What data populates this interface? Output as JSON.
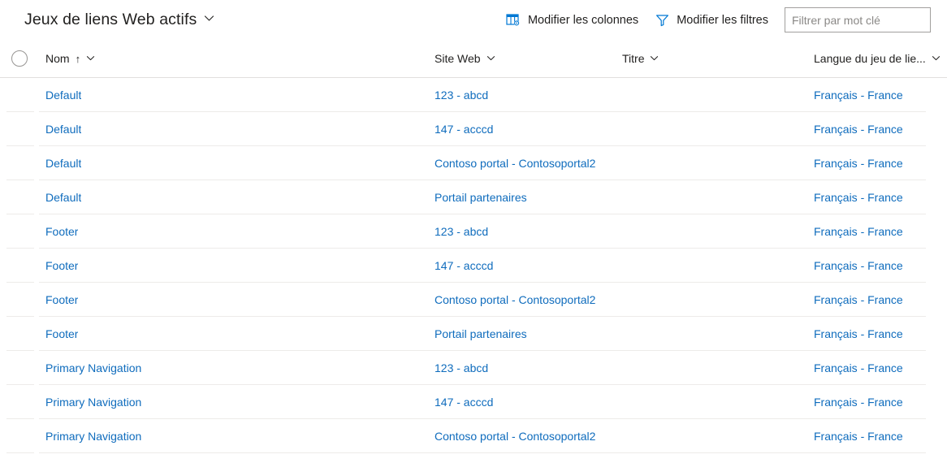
{
  "header": {
    "title": "Jeux de liens Web actifs",
    "title_chevron_icon": "chevron-down-icon",
    "toolbar": [
      {
        "label": "Modifier les colonnes",
        "icon": "edit-columns-icon"
      },
      {
        "label": "Modifier les filtres",
        "icon": "filter-icon"
      }
    ],
    "search": {
      "placeholder": "Filtrer par mot clé",
      "value": ""
    }
  },
  "grid": {
    "select_all_icon": "select-all-circle-icon",
    "columns": [
      {
        "label": "Nom",
        "sort": "ascending",
        "sort_icon": "sort-ascending-arrow",
        "chevron_icon": "chevron-down-icon"
      },
      {
        "label": "Site Web",
        "sort": "none",
        "chevron_icon": "chevron-down-icon"
      },
      {
        "label": "Titre",
        "sort": "none",
        "chevron_icon": "chevron-down-icon"
      },
      {
        "label": "Langue du jeu de lie...",
        "sort": "none",
        "chevron_icon": "chevron-down-icon"
      }
    ],
    "rows": [
      {
        "nom": "Default",
        "site": "123 - abcd",
        "titre": "",
        "langue": "Français - France"
      },
      {
        "nom": "Default",
        "site": "147 - acccd",
        "titre": "",
        "langue": "Français - France"
      },
      {
        "nom": "Default",
        "site": "Contoso portal - Contosoportal2",
        "titre": "",
        "langue": "Français - France"
      },
      {
        "nom": "Default",
        "site": "Portail partenaires",
        "titre": "",
        "langue": "Français - France"
      },
      {
        "nom": "Footer",
        "site": "123 - abcd",
        "titre": "",
        "langue": "Français - France"
      },
      {
        "nom": "Footer",
        "site": "147 - acccd",
        "titre": "",
        "langue": "Français - France"
      },
      {
        "nom": "Footer",
        "site": "Contoso portal - Contosoportal2",
        "titre": "",
        "langue": "Français - France"
      },
      {
        "nom": "Footer",
        "site": "Portail partenaires",
        "titre": "",
        "langue": "Français - France"
      },
      {
        "nom": "Primary Navigation",
        "site": "123 - abcd",
        "titre": "",
        "langue": "Français - France"
      },
      {
        "nom": "Primary Navigation",
        "site": "147 - acccd",
        "titre": "",
        "langue": "Français - France"
      },
      {
        "nom": "Primary Navigation",
        "site": "Contoso portal - Contosoportal2",
        "titre": "",
        "langue": "Français - France"
      }
    ]
  },
  "colors": {
    "link": "#0f6cbd",
    "icon_accent": "#0078d4",
    "text": "#201f1e",
    "rule": "#edebe9"
  }
}
